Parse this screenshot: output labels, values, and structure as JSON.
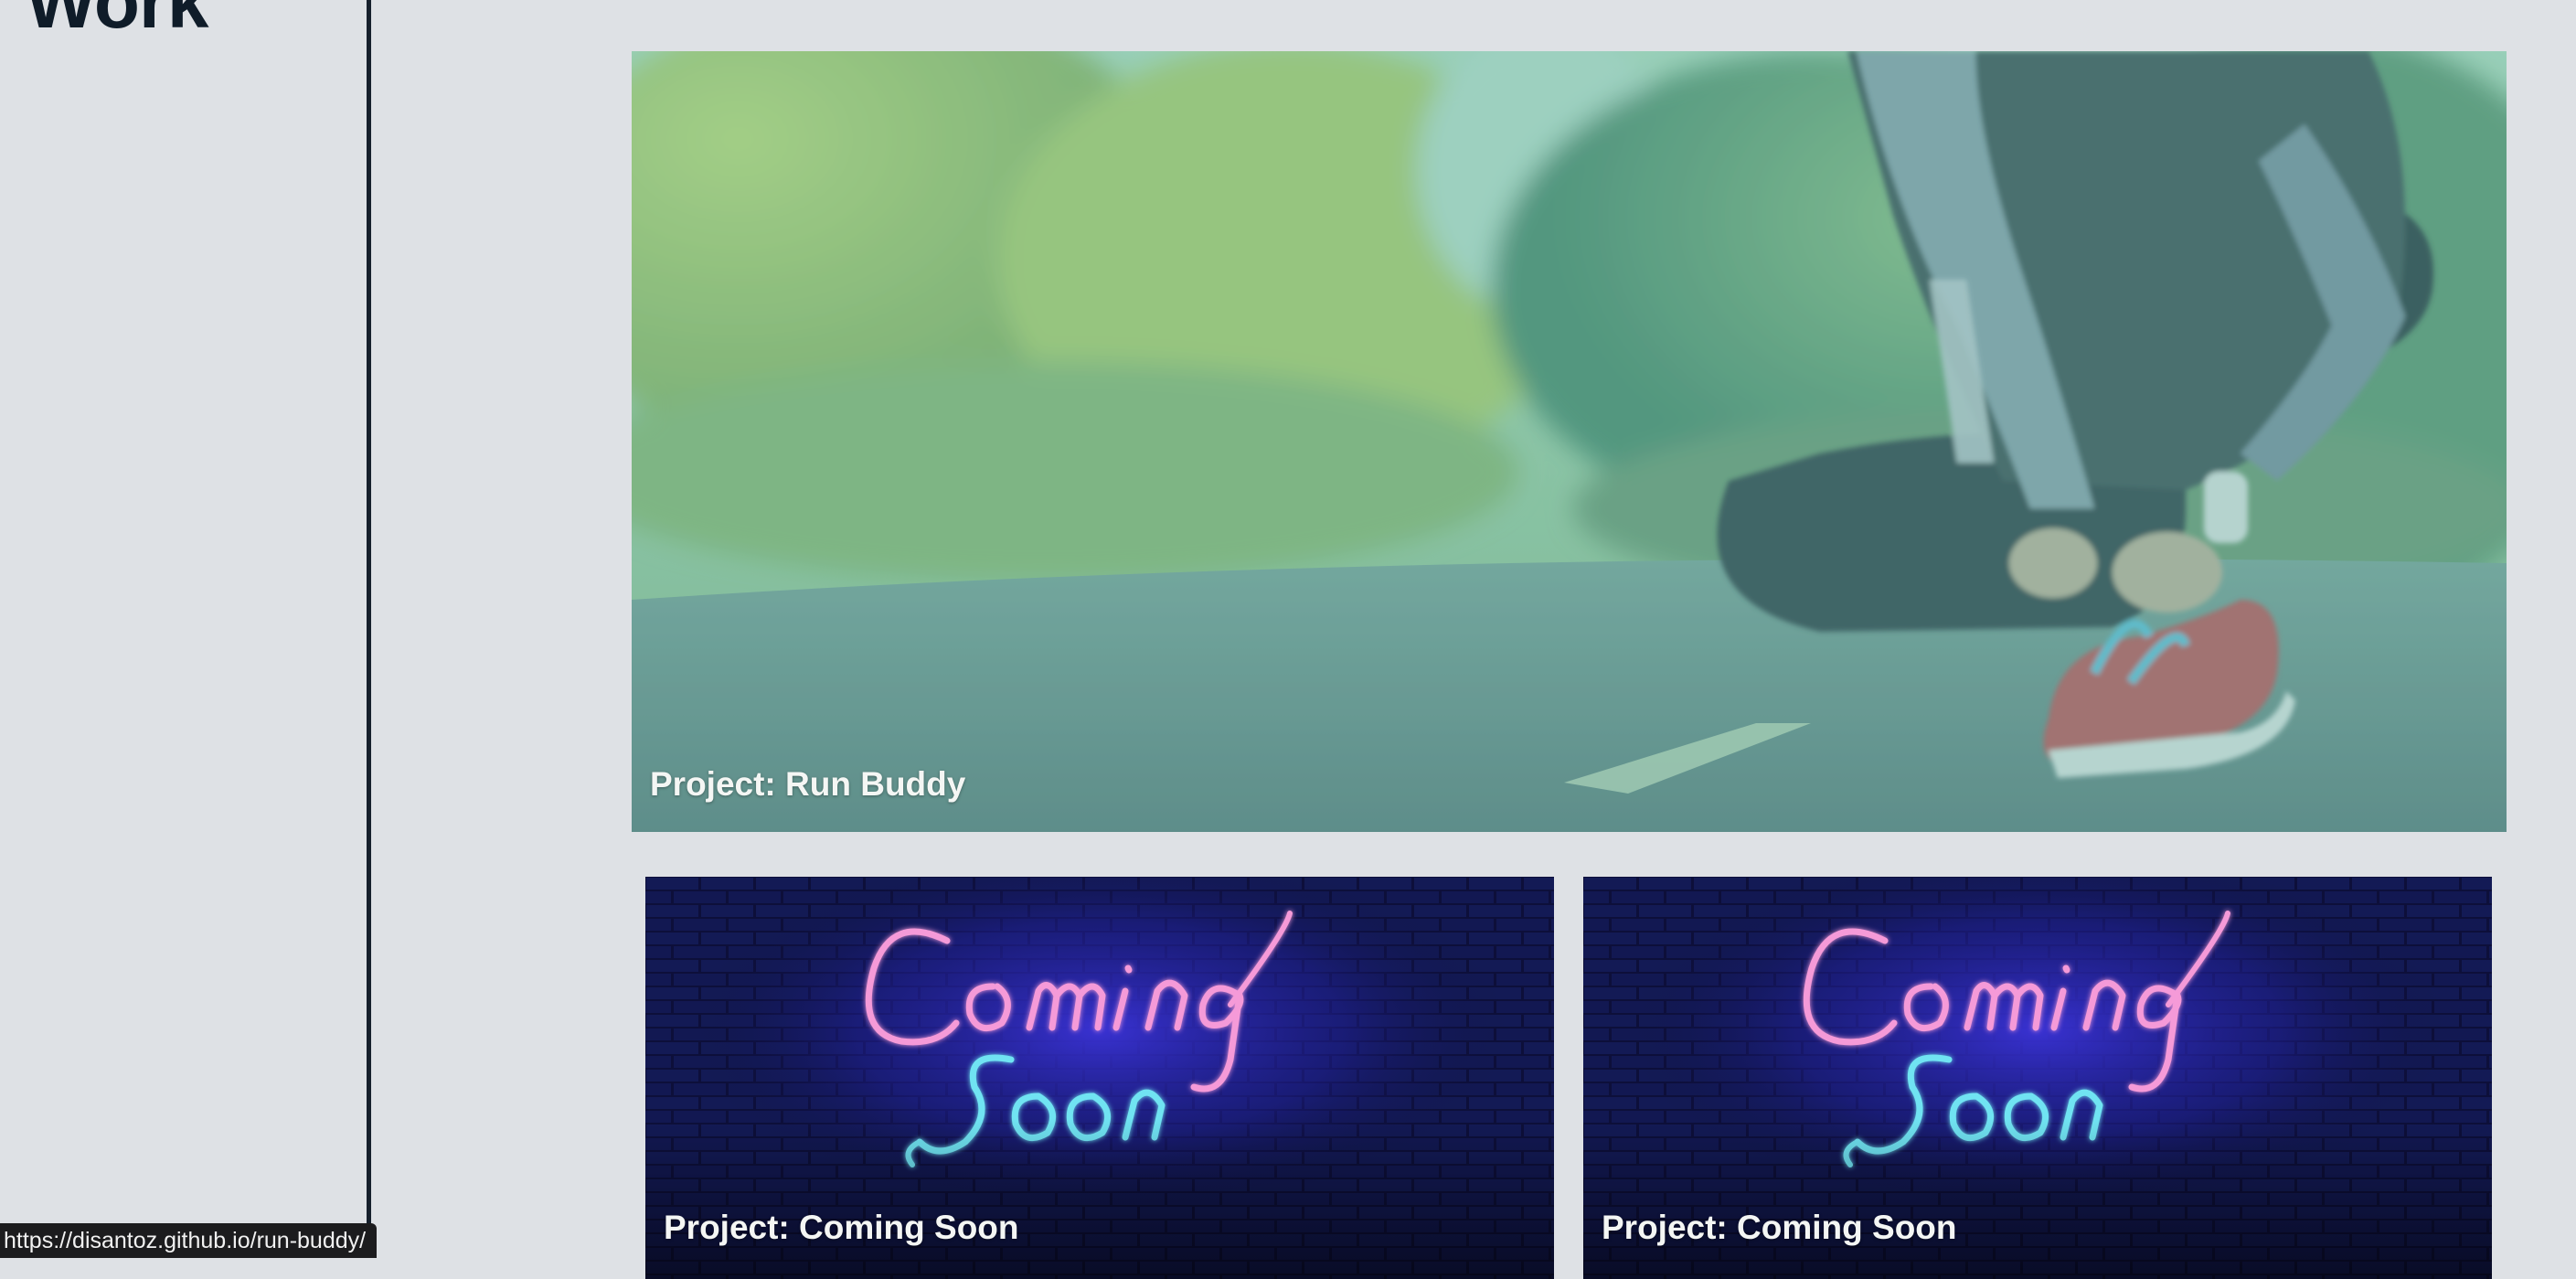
{
  "section": {
    "title": "Work"
  },
  "projects": [
    {
      "label": "Project: Run Buddy",
      "url": "https://disantoz.github.io/run-buddy/",
      "image_icon": "runner-tying-shoe-image"
    },
    {
      "label": "Project: Coming Soon",
      "image_icon": "neon-coming-soon-image"
    },
    {
      "label": "Project: Coming Soon",
      "image_icon": "neon-coming-soon-image"
    }
  ],
  "status_bar": {
    "url": "https://disantoz.github.io/run-buddy/"
  },
  "colors": {
    "page_background": "#dee1e5",
    "heading": "#0f1c29",
    "divider": "#16202c",
    "hero_overlay": "#7fd6c2",
    "neon_pink": "#f59ad8",
    "neon_cyan": "#6fe3f2",
    "brick_dark": "#0d0f3a"
  }
}
